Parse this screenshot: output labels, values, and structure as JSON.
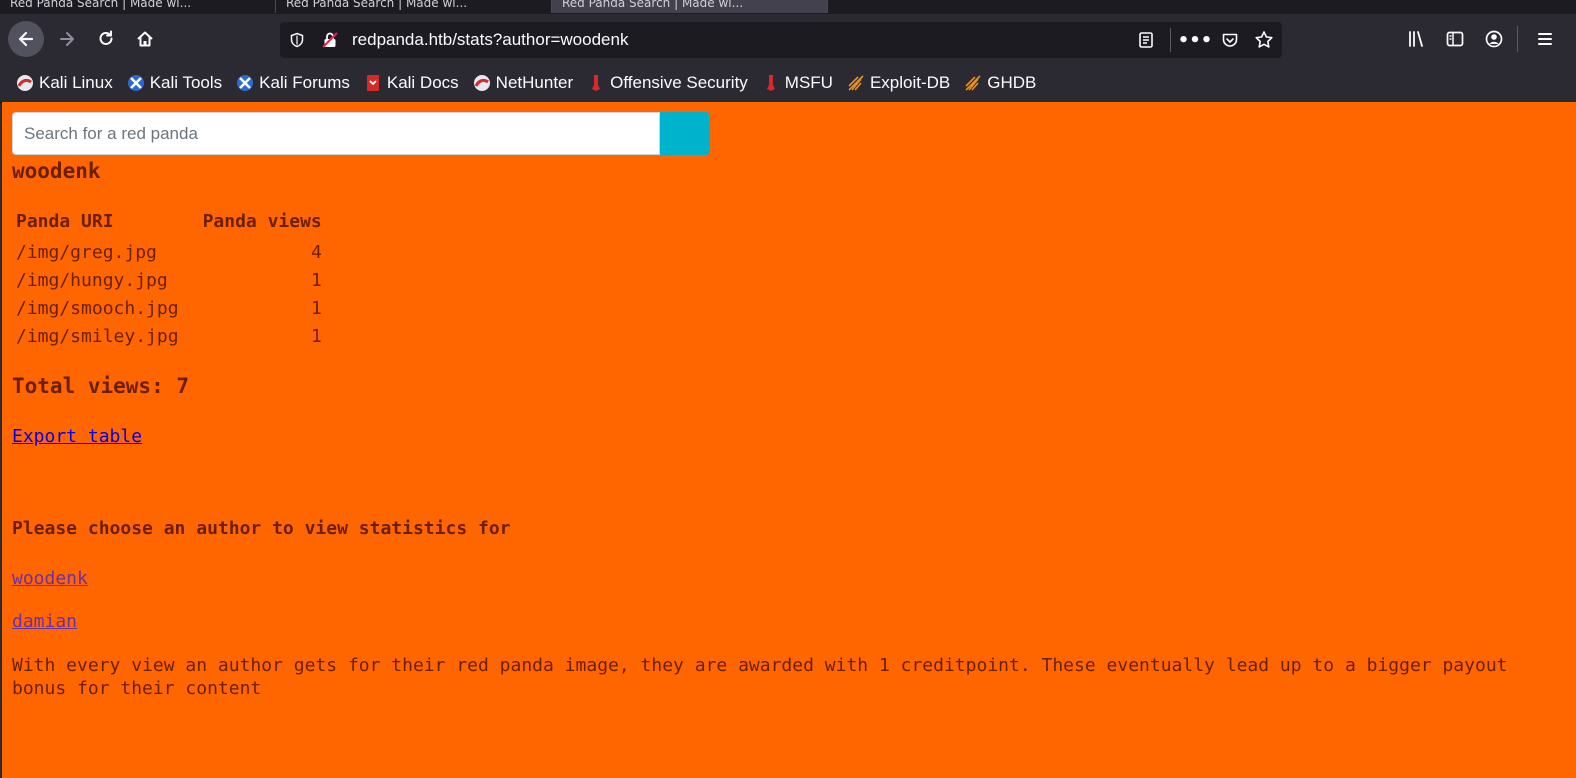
{
  "browser": {
    "tabs": [
      {
        "label": "Red Panda Search | Made wi..."
      },
      {
        "label": "Red Panda Search | Made wi..."
      },
      {
        "label": "Red Panda Search | Made wi..."
      }
    ],
    "url": "redpanda.htb/stats?author=woodenk",
    "bookmarks": [
      {
        "label": "Kali Linux",
        "icon": "kali-dragon-icon"
      },
      {
        "label": "Kali Tools",
        "icon": "kali-tools-icon"
      },
      {
        "label": "Kali Forums",
        "icon": "kali-forums-icon"
      },
      {
        "label": "Kali Docs",
        "icon": "kali-docs-icon"
      },
      {
        "label": "NetHunter",
        "icon": "nethunter-icon"
      },
      {
        "label": "Offensive Security",
        "icon": "offsec-icon"
      },
      {
        "label": "MSFU",
        "icon": "msfu-icon"
      },
      {
        "label": "Exploit-DB",
        "icon": "exploit-db-icon"
      },
      {
        "label": "GHDB",
        "icon": "ghdb-icon"
      }
    ]
  },
  "page": {
    "background": "#ff6600",
    "search": {
      "placeholder": "Search for a red panda",
      "button_color": "#00b3cc"
    },
    "author": "woodenk",
    "table": {
      "headers": [
        "Panda URI",
        "Panda views"
      ],
      "rows": [
        {
          "uri": "/img/greg.jpg",
          "views": "4"
        },
        {
          "uri": "/img/hungy.jpg",
          "views": "1"
        },
        {
          "uri": "/img/smooch.jpg",
          "views": "1"
        },
        {
          "uri": "/img/smiley.jpg",
          "views": "1"
        }
      ]
    },
    "total_views": "Total views: 7",
    "export_link": "Export table",
    "choose_heading": "Please choose an author to view statistics for",
    "authors": [
      "woodenk",
      "damian"
    ],
    "note": "With every view an author gets for their red panda image, they are awarded with 1 creditpoint. These eventually lead up to a bigger payout bonus for their content"
  }
}
